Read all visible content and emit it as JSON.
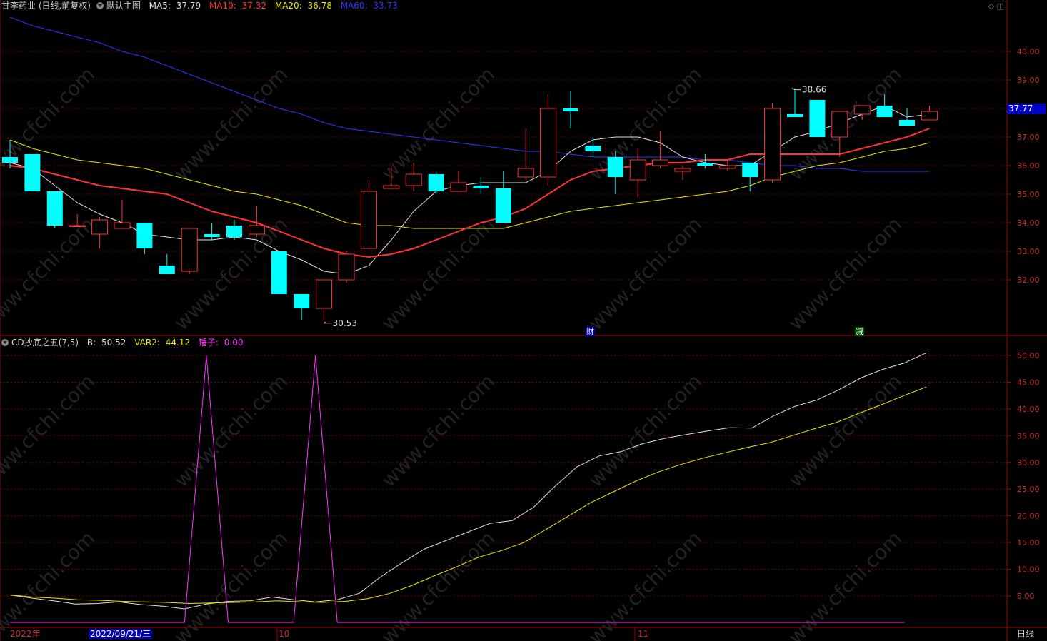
{
  "header": {
    "title": "甘李药业 (日线,前复权)",
    "main_chart_label": "默认主图",
    "ma5": {
      "label": "MA5:",
      "value": "37.79",
      "color": "#e0e0e0"
    },
    "ma10": {
      "label": "MA10:",
      "value": "37.32",
      "color": "#ff3333"
    },
    "ma20": {
      "label": "MA20:",
      "value": "36.78",
      "color": "#e8e800"
    },
    "ma60": {
      "label": "MA60:",
      "value": "33.73",
      "color": "#3333ff"
    }
  },
  "indicator_header": {
    "name": "CD抄底之五(7,5)",
    "b": {
      "label": "B:",
      "value": "50.52",
      "color": "#e0e0e0"
    },
    "var2": {
      "label": "VAR2:",
      "value": "44.12",
      "color": "#e8e800"
    },
    "hammer": {
      "label": "锤子:",
      "value": "0.00",
      "color": "#ff33ff"
    }
  },
  "price_axis": {
    "ticks": [
      "40.00",
      "39.00",
      "38.00",
      "37.00",
      "36.00",
      "35.00",
      "34.00",
      "33.00",
      "32.00"
    ]
  },
  "indicator_axis": {
    "ticks": [
      "50.00",
      "45.00",
      "40.00",
      "35.00",
      "30.00",
      "25.00",
      "20.00",
      "15.00",
      "10.00",
      "5.00"
    ]
  },
  "last_price": "37.77",
  "annotations": {
    "high": "38.66",
    "low": "30.53"
  },
  "events": [
    {
      "label": "财",
      "bg": "#0000aa",
      "color": "#ffffff"
    },
    {
      "label": "减",
      "bg": "#005500",
      "color": "#ffffff"
    }
  ],
  "x_axis": {
    "year_label": "2022年",
    "cursor_date": "2022/09/21/三",
    "months": [
      "10",
      "11"
    ],
    "period": "日线"
  },
  "colors": {
    "up": "#ff3333",
    "down": "#00ffff",
    "grid": "#7a0000",
    "axis": "#b00000"
  },
  "chart_data": [
    {
      "type": "candlestick",
      "y_range": [
        31.4,
        41.5
      ],
      "candles": [
        [
          36.3,
          36.1,
          36.9,
          35.9
        ],
        [
          36.4,
          35.1,
          36.4,
          35.1
        ],
        [
          35.1,
          33.9,
          35.1,
          33.8
        ],
        [
          33.9,
          33.9,
          34.3,
          33.9
        ],
        [
          33.6,
          34.1,
          34.2,
          33.1
        ],
        [
          33.8,
          34.0,
          34.8,
          33.8
        ],
        [
          34.0,
          33.1,
          34.0,
          32.9
        ],
        [
          32.5,
          32.2,
          32.9,
          32.2
        ],
        [
          32.3,
          33.8,
          33.8,
          32.2
        ],
        [
          33.6,
          33.5,
          34.0,
          33.4
        ],
        [
          33.9,
          33.5,
          34.1,
          33.4
        ],
        [
          33.6,
          33.9,
          34.6,
          33.5
        ],
        [
          33.0,
          31.5,
          33.0,
          31.5
        ],
        [
          31.5,
          31.0,
          31.5,
          30.6
        ],
        [
          31.0,
          32.0,
          32.0,
          30.5
        ],
        [
          32.0,
          32.9,
          33.0,
          31.9
        ],
        [
          33.1,
          35.1,
          35.5,
          33.1
        ],
        [
          35.2,
          35.3,
          36.0,
          35.2
        ],
        [
          35.3,
          35.7,
          36.1,
          35.1
        ],
        [
          35.7,
          35.1,
          35.8,
          35.0
        ],
        [
          35.1,
          35.4,
          35.8,
          35.1
        ],
        [
          35.3,
          35.2,
          35.6,
          35.0
        ],
        [
          35.2,
          34.0,
          35.8,
          34.0
        ],
        [
          35.6,
          35.9,
          37.3,
          35.5
        ],
        [
          35.6,
          38.0,
          38.5,
          35.3
        ],
        [
          38.0,
          37.9,
          38.6,
          37.3
        ],
        [
          36.7,
          36.5,
          37.0,
          36.3
        ],
        [
          36.3,
          35.6,
          36.5,
          35.0
        ],
        [
          35.5,
          36.2,
          36.6,
          34.9
        ],
        [
          36.0,
          36.2,
          37.2,
          35.9
        ],
        [
          35.8,
          35.9,
          36.0,
          35.5
        ],
        [
          36.1,
          36.0,
          36.4,
          35.9
        ],
        [
          35.9,
          36.0,
          36.2,
          35.8
        ],
        [
          36.1,
          35.6,
          36.1,
          35.1
        ],
        [
          35.5,
          38.0,
          38.2,
          35.4
        ],
        [
          37.8,
          37.7,
          38.7,
          37.7
        ],
        [
          38.3,
          37.0,
          38.3,
          37.0
        ],
        [
          37.0,
          37.9,
          37.9,
          36.3
        ],
        [
          37.8,
          38.1,
          38.1,
          37.6
        ],
        [
          38.1,
          37.7,
          38.5,
          37.7
        ],
        [
          37.6,
          37.4,
          38.0,
          37.4
        ],
        [
          37.6,
          37.9,
          38.1,
          37.6
        ]
      ],
      "ma5": [
        36.1,
        35.9,
        35.3,
        34.7,
        34.3,
        34.0,
        33.6,
        33.5,
        33.4,
        33.4,
        33.5,
        33.4,
        33.0,
        32.7,
        32.3,
        32.2,
        32.5,
        33.4,
        34.4,
        35.1,
        35.3,
        35.4,
        35.4,
        35.4,
        35.8,
        36.5,
        36.9,
        37.0,
        37.0,
        36.8,
        36.3,
        36.1,
        36.0,
        36.0,
        36.5,
        37.0,
        37.2,
        37.5,
        37.8,
        38.1,
        37.7,
        37.8
      ],
      "ma10": [
        36.0,
        35.9,
        35.7,
        35.5,
        35.3,
        35.2,
        35.1,
        35.0,
        34.7,
        34.4,
        34.2,
        34.0,
        33.7,
        33.4,
        33.1,
        32.9,
        32.8,
        32.9,
        33.1,
        33.4,
        33.7,
        34.0,
        34.2,
        34.5,
        35.0,
        35.5,
        35.8,
        35.9,
        36.0,
        36.1,
        36.1,
        36.2,
        36.2,
        36.4,
        36.4,
        36.4,
        36.4,
        36.4,
        36.6,
        36.8,
        37.0,
        37.3
      ],
      "ma20": [
        36.9,
        36.6,
        36.4,
        36.2,
        36.1,
        36.0,
        35.9,
        35.7,
        35.5,
        35.3,
        35.1,
        35.0,
        34.8,
        34.6,
        34.3,
        34.0,
        33.9,
        33.9,
        33.8,
        33.8,
        33.8,
        33.8,
        33.8,
        34.0,
        34.2,
        34.4,
        34.5,
        34.6,
        34.7,
        34.8,
        34.9,
        35.0,
        35.1,
        35.3,
        35.6,
        35.8,
        36.0,
        36.1,
        36.3,
        36.5,
        36.6,
        36.8
      ],
      "ma60": [
        41.2,
        40.9,
        40.7,
        40.5,
        40.3,
        40.0,
        39.8,
        39.5,
        39.2,
        38.9,
        38.6,
        38.3,
        38.0,
        37.8,
        37.5,
        37.3,
        37.2,
        37.1,
        37.0,
        36.9,
        36.8,
        36.7,
        36.6,
        36.5,
        36.5,
        36.4,
        36.3,
        36.3,
        36.3,
        36.3,
        36.3,
        36.2,
        36.2,
        36.1,
        36.0,
        36.0,
        35.9,
        35.9,
        35.8,
        35.8,
        35.8,
        35.8
      ]
    },
    {
      "type": "line",
      "y_range": [
        0,
        55
      ],
      "series": [
        {
          "name": "B",
          "color": "#e0e0e0",
          "values": [
            5.2,
            4.6,
            4.1,
            3.5,
            3.6,
            3.9,
            3.4,
            3.1,
            2.6,
            3.5,
            4.0,
            4.1,
            4.8,
            4.3,
            3.9,
            4.3,
            5.5,
            8.6,
            11.3,
            13.8,
            15.4,
            17.0,
            18.6,
            19.1,
            21.6,
            25.6,
            29.2,
            31.2,
            32.0,
            33.5,
            34.5,
            35.2,
            35.9,
            36.5,
            36.4,
            38.7,
            40.5,
            41.7,
            43.6,
            45.8,
            47.4,
            48.6,
            50.5
          ]
        },
        {
          "name": "VAR2",
          "color": "#e8e800",
          "values": [
            5.2,
            4.8,
            4.6,
            4.3,
            4.2,
            4.0,
            3.9,
            3.8,
            3.6,
            3.7,
            3.8,
            3.9,
            4.1,
            3.9,
            3.8,
            4.0,
            4.5,
            5.5,
            7.0,
            8.8,
            10.5,
            12.3,
            13.5,
            15.0,
            17.5,
            20.0,
            22.5,
            24.5,
            26.5,
            28.2,
            29.6,
            30.8,
            31.8,
            32.8,
            33.7,
            35.0,
            36.3,
            37.5,
            39.2,
            40.8,
            42.5,
            44.1
          ]
        },
        {
          "name": "锤子",
          "color": "#ff33ff",
          "values": [
            0,
            0,
            0,
            0,
            0,
            0,
            0,
            0,
            0,
            50,
            0,
            0,
            0,
            0,
            50,
            0,
            0,
            0,
            0,
            0,
            0,
            0,
            0,
            0,
            0,
            0,
            0,
            0,
            0,
            0,
            0,
            0,
            0,
            0,
            0,
            0,
            0,
            0,
            0,
            0,
            0,
            0
          ]
        }
      ]
    }
  ]
}
